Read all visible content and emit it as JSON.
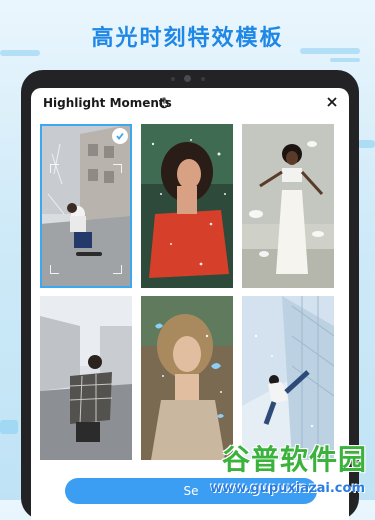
{
  "banner": {
    "title": "高光时刻特效模板"
  },
  "dialog": {
    "title": "Highlight Moments",
    "title_icon": "timer-sparkle-icon",
    "close_icon": "close-icon"
  },
  "templates": [
    {
      "name": "skateboard-street",
      "selected": true
    },
    {
      "name": "red-dress-sparkle",
      "selected": false
    },
    {
      "name": "white-outfit-feathers",
      "selected": false
    },
    {
      "name": "plaid-jacket-road",
      "selected": false
    },
    {
      "name": "butterfly-portrait",
      "selected": false
    },
    {
      "name": "dancer-architecture",
      "selected": false
    }
  ],
  "cta": {
    "label": "Se"
  },
  "watermark": {
    "cn": "谷普软件园",
    "url": "www.gupuxiazai.com"
  },
  "colors": {
    "accent": "#3b9ef2",
    "banner_text": "#1f87e6",
    "watermark_green": "#3bb23b"
  }
}
